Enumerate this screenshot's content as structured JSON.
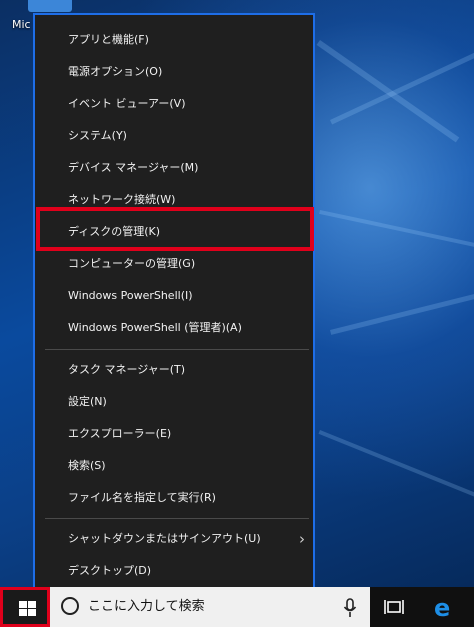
{
  "desktop": {
    "icon_label": "Mic"
  },
  "menu": {
    "groups": [
      [
        {
          "label": "アプリと機能(F)"
        },
        {
          "label": "電源オプション(O)"
        },
        {
          "label": "イベント ビューアー(V)"
        },
        {
          "label": "システム(Y)"
        },
        {
          "label": "デバイス マネージャー(M)"
        },
        {
          "label": "ネットワーク接続(W)"
        },
        {
          "label": "ディスクの管理(K)"
        },
        {
          "label": "コンピューターの管理(G)"
        },
        {
          "label": "Windows PowerShell(I)"
        },
        {
          "label": "Windows PowerShell (管理者)(A)"
        }
      ],
      [
        {
          "label": "タスク マネージャー(T)"
        },
        {
          "label": "設定(N)"
        },
        {
          "label": "エクスプローラー(E)"
        },
        {
          "label": "検索(S)"
        },
        {
          "label": "ファイル名を指定して実行(R)"
        }
      ],
      [
        {
          "label": "シャットダウンまたはサインアウト(U)",
          "submenu": true
        },
        {
          "label": "デスクトップ(D)"
        }
      ]
    ],
    "highlighted_item": "ディスクの管理(K)",
    "highlight_color": "#e0001b",
    "border_color": "#1e6ee8"
  },
  "taskbar": {
    "search_placeholder": "ここに入力して検索",
    "icons": [
      "windows-start-icon",
      "search-circle-icon",
      "microphone-icon",
      "task-view-icon",
      "edge-browser-icon"
    ]
  }
}
